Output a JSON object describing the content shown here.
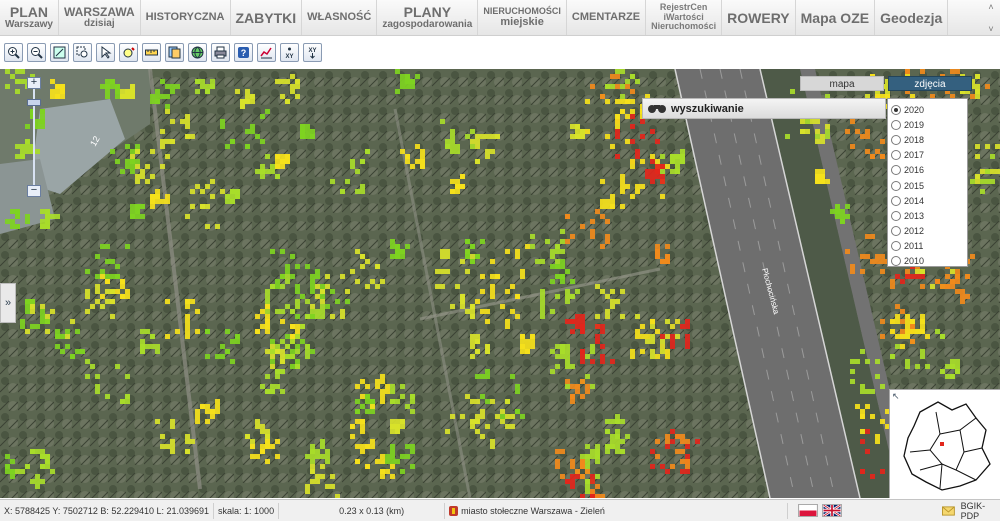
{
  "topnav": {
    "tabs": [
      {
        "name": "tab-plan-warszawy",
        "title": "PLAN",
        "sub": "Warszawy",
        "style": "big"
      },
      {
        "name": "tab-warszawa-dzisiaj",
        "title": "WARSZAWA",
        "sub": "dzisiaj",
        "style": ""
      },
      {
        "name": "tab-historyczna",
        "title": "HISTORYCZNA",
        "sub": "",
        "style": "caps"
      },
      {
        "name": "tab-zabytki",
        "title": "ZABYTKI",
        "sub": "",
        "style": "big"
      },
      {
        "name": "tab-wlasnosc",
        "title": "WŁASNOŚĆ",
        "sub": "",
        "style": "caps"
      },
      {
        "name": "tab-plany",
        "title": "PLANY",
        "sub": "zagospodarowania",
        "style": "big"
      },
      {
        "name": "tab-nieruchomosci",
        "title": "NIERUCHOMOŚCI",
        "sub": "miejskie",
        "style": "small"
      },
      {
        "name": "tab-cmentarze",
        "title": "CMENTARZE",
        "sub": "",
        "style": "caps"
      },
      {
        "name": "tab-rejestr",
        "title": "",
        "sub": "",
        "style": "rejestr",
        "lines": [
          "RejestrCen",
          "iWartości",
          "Nieruchomości"
        ]
      },
      {
        "name": "tab-rowery",
        "title": "ROWERY",
        "sub": "",
        "style": "big"
      },
      {
        "name": "tab-mapa-oze",
        "title": "Mapa OZE",
        "sub": "",
        "style": "big"
      },
      {
        "name": "tab-geodezja",
        "title": "Geodezja",
        "sub": "",
        "style": "big"
      }
    ]
  },
  "toolbar": {
    "buttons": [
      "zoom-in-icon",
      "zoom-out-icon",
      "zoom-extent-icon",
      "zoom-window-icon",
      "select-pointer-icon",
      "pan-icon",
      "measure-ruler-icon",
      "layers-icon",
      "globe-icon",
      "print-icon",
      "help-icon",
      "chart-icon",
      "coordinates-xy-icon",
      "goto-xy-icon"
    ]
  },
  "map": {
    "layer_tabs": [
      {
        "label": "mapa",
        "active": false
      },
      {
        "label": "zdjęcia",
        "active": true
      }
    ],
    "search_label": "wyszukiwanie",
    "road_label": "Płochocińska",
    "building_number": "12",
    "years": [
      "2020",
      "2019",
      "2018",
      "2017",
      "2016",
      "2015",
      "2014",
      "2013",
      "2012",
      "2011",
      "2010"
    ],
    "selected_year": "2020"
  },
  "status": {
    "coords": "X: 5788425 Y: 7502712  B: 52.229410 L: 21.039691",
    "scale": "skala: 1: 1000",
    "extent": "0.23 x 0.13 (km)",
    "source": "miasto stołeczne Warszawa - Zieleń",
    "right_label": "BGIK-PDP"
  },
  "colors": {
    "tab_text": "#6e6e6e",
    "active_layer_tab": "#34607f",
    "ndvi_green": "#7ed321",
    "ndvi_yellow": "#f5e11b",
    "ndvi_orange": "#f08a1c",
    "ndvi_red": "#e2261c"
  }
}
